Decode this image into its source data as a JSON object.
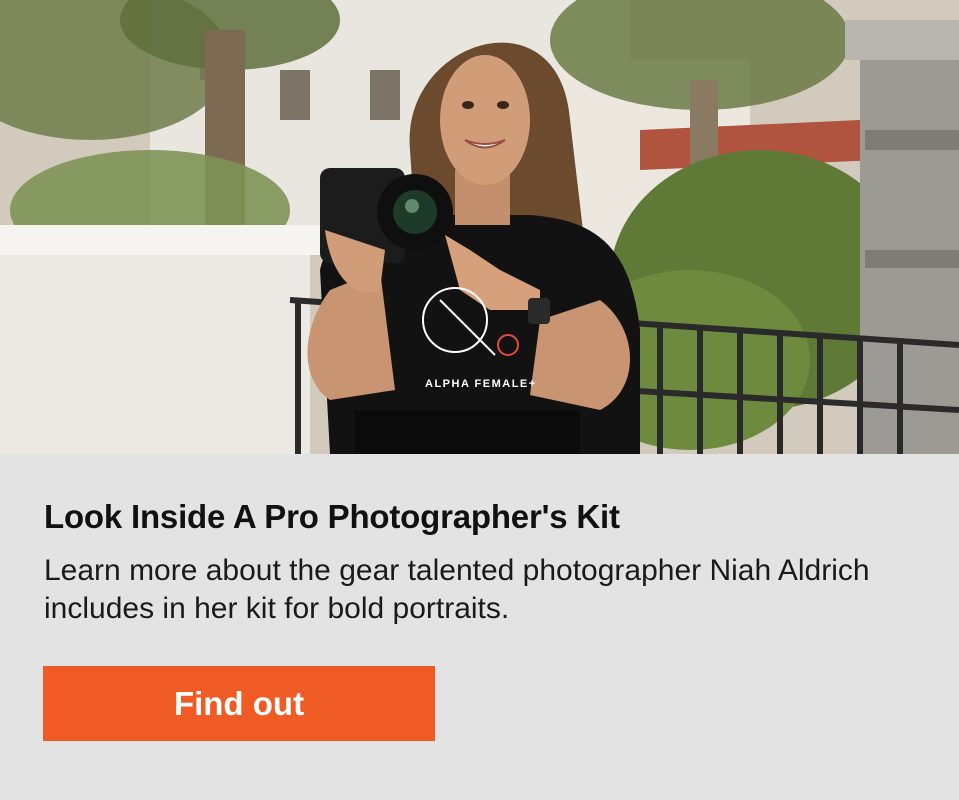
{
  "hero": {
    "shirt_text": "ALPHA FEMALE+"
  },
  "card": {
    "headline": "Look Inside A Pro Photographer's Kit",
    "description": "Learn more about the gear talented photographer Niah Aldrich includes in her kit for bold portraits.",
    "cta_label": "Find out"
  },
  "colors": {
    "panel_background": "#e3e3e3",
    "cta_background": "#f05a24",
    "cta_text": "#ffffff",
    "headline_text": "#111111"
  }
}
